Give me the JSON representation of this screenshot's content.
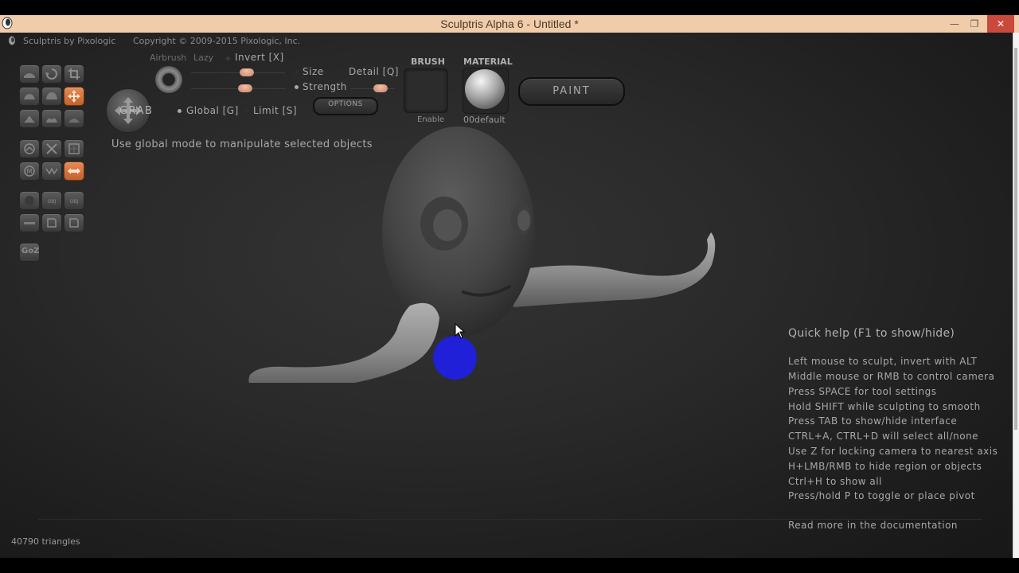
{
  "window": {
    "title": "Sculptris Alpha 6 - Untitled *",
    "minimize_glyph": "—",
    "restore_glyph": "❐",
    "close_glyph": "✕"
  },
  "infobar": {
    "app_name": "Sculptris by Pixologic",
    "copyright": "Copyright © 2009-2015 Pixologic, Inc."
  },
  "tool": {
    "name": "GRAB",
    "airbrush": "Airbrush",
    "lazy": "Lazy",
    "invert": "Invert [X]",
    "size": "Size",
    "detail": "Detail [Q]",
    "strength": "Strength",
    "options": "OPTIONS",
    "global": "Global [G]",
    "limit": "Limit [S]",
    "status_message": "Use global mode to manipulate selected objects"
  },
  "brush": {
    "label": "BRUSH",
    "enable": "Enable"
  },
  "material": {
    "label": "MATERIAL",
    "name": "00default"
  },
  "paint_button": "PAINT",
  "toolbar_icons": {
    "row1": [
      "draw-icon",
      "rotate-icon",
      "crop-icon"
    ],
    "row2": [
      "flatten-icon",
      "inflate-icon",
      "grab-icon"
    ],
    "row3": [
      "pinch-icon",
      "crease-icon",
      "smooth-icon"
    ],
    "row4": [
      "reduce-icon",
      "cut-icon",
      "mask-icon"
    ],
    "row5": [
      "symmetry-icon",
      "wireframe-icon",
      "move-arrows-icon"
    ],
    "row6": [
      "sphere-icon",
      "import-obj-icon",
      "export-obj-icon"
    ],
    "row7": [
      "plane-icon",
      "save-icon",
      "open-icon"
    ],
    "goz": "GoZ"
  },
  "quick_help": {
    "title": "Quick help (F1 to show/hide)",
    "lines": [
      "Left mouse to sculpt, invert with ALT",
      "Middle mouse or RMB to control camera",
      "Press SPACE for tool settings",
      "Hold SHIFT while sculpting to smooth",
      "Press TAB to show/hide interface",
      "CTRL+A, CTRL+D will select all/none",
      "Use Z for locking camera to nearest axis",
      "H+LMB/RMB to hide region or objects",
      "Ctrl+H to show all",
      "Press/hold P to toggle or place pivot"
    ],
    "footer": "Read more in the documentation"
  },
  "status": {
    "triangles": "40790 triangles"
  },
  "colors": {
    "titlebar": "#f0ccaa",
    "accent_orange": "#d9743e",
    "cursor_highlight": "#2020d8"
  }
}
